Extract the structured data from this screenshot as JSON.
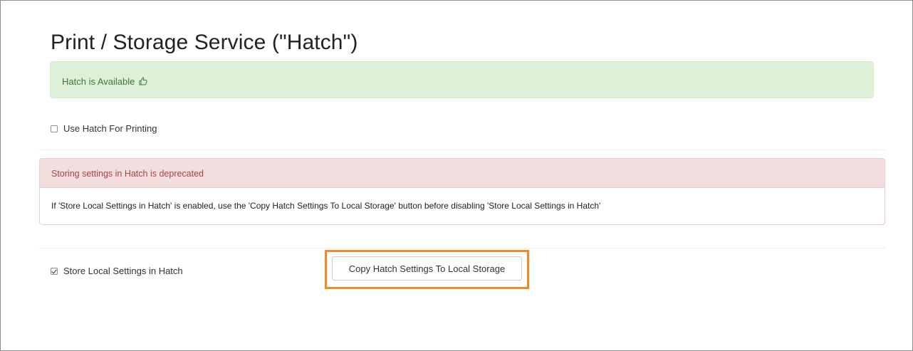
{
  "page": {
    "title": "Print / Storage Service (\"Hatch\")"
  },
  "status_alert": {
    "text": "Hatch is Available",
    "icon": "thumbs-up-icon",
    "color": "#3c763d",
    "background": "#dff0d8"
  },
  "use_hatch_printing": {
    "label": "Use Hatch For Printing",
    "checked": false
  },
  "deprecation_panel": {
    "heading": "Storing settings in Hatch is deprecated",
    "body": "If 'Store Local Settings in Hatch' is enabled, use the 'Copy Hatch Settings To Local Storage' button before disabling 'Store Local Settings in Hatch'",
    "heading_color": "#a94442",
    "heading_background": "#f2dede"
  },
  "store_local_settings": {
    "label": "Store Local Settings in Hatch",
    "checked": true
  },
  "copy_button": {
    "label": "Copy Hatch Settings To Local Storage",
    "highlight_color": "#f08a24"
  }
}
